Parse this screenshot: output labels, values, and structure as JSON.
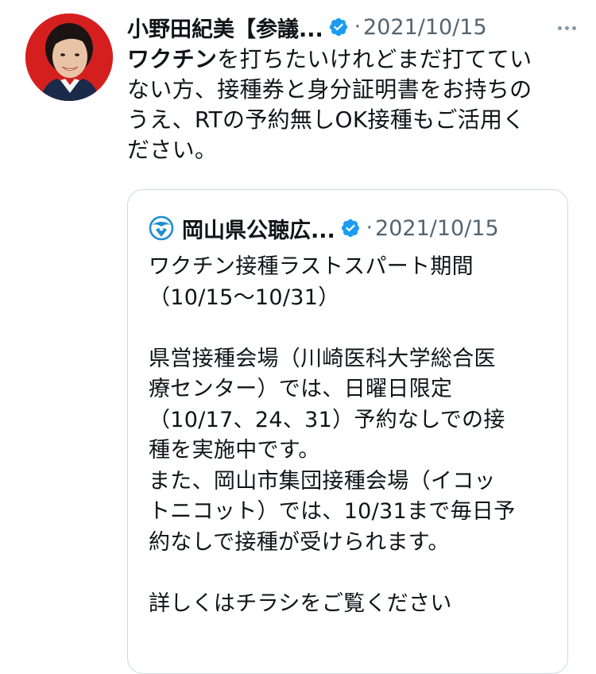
{
  "tweet": {
    "author_name": "小野田紀美【参議...",
    "separator": "·",
    "date": "2021/10/15",
    "text_lines": [
      {
        "bold": "ワクチン",
        "rest": "を打ちたいけれどまだ打ててい"
      },
      {
        "bold": "",
        "rest": "ない方、接種券と身分証明書をお持ちの"
      },
      {
        "bold": "",
        "rest": "うえ、RTの予約無しOK接種もご活用く"
      },
      {
        "bold": "",
        "rest": "ださい。"
      }
    ]
  },
  "quote": {
    "author_name": "岡山県公聴広...",
    "separator": "·",
    "date": "2021/10/15",
    "text_lines": [
      "ワクチン接種ラストスパート期間",
      "（10/15〜10/31）",
      "",
      "県営接種会場（川崎医科大学総合医",
      "療センター）では、日曜日限定",
      "（10/17、24、31）予約なしでの接",
      "種を実施中です。",
      "また、岡山市集団接種会場（イコッ",
      "トニコット）では、10/31まで毎日予",
      "約なしで接種が受けられます。",
      "",
      "詳しくはチラシをご覧ください"
    ]
  },
  "icons": {
    "verified": "verified-badge-icon",
    "more": "more-options-icon",
    "quote_logo": "okayama-prefecture-logo-icon",
    "avatar": "avatar"
  },
  "colors": {
    "verified_blue": "#1d9bf0",
    "muted_text": "#536471",
    "border": "#cfd9de",
    "logo_blue": "#1f8ed0",
    "avatar_bg": "#d51f1f"
  }
}
